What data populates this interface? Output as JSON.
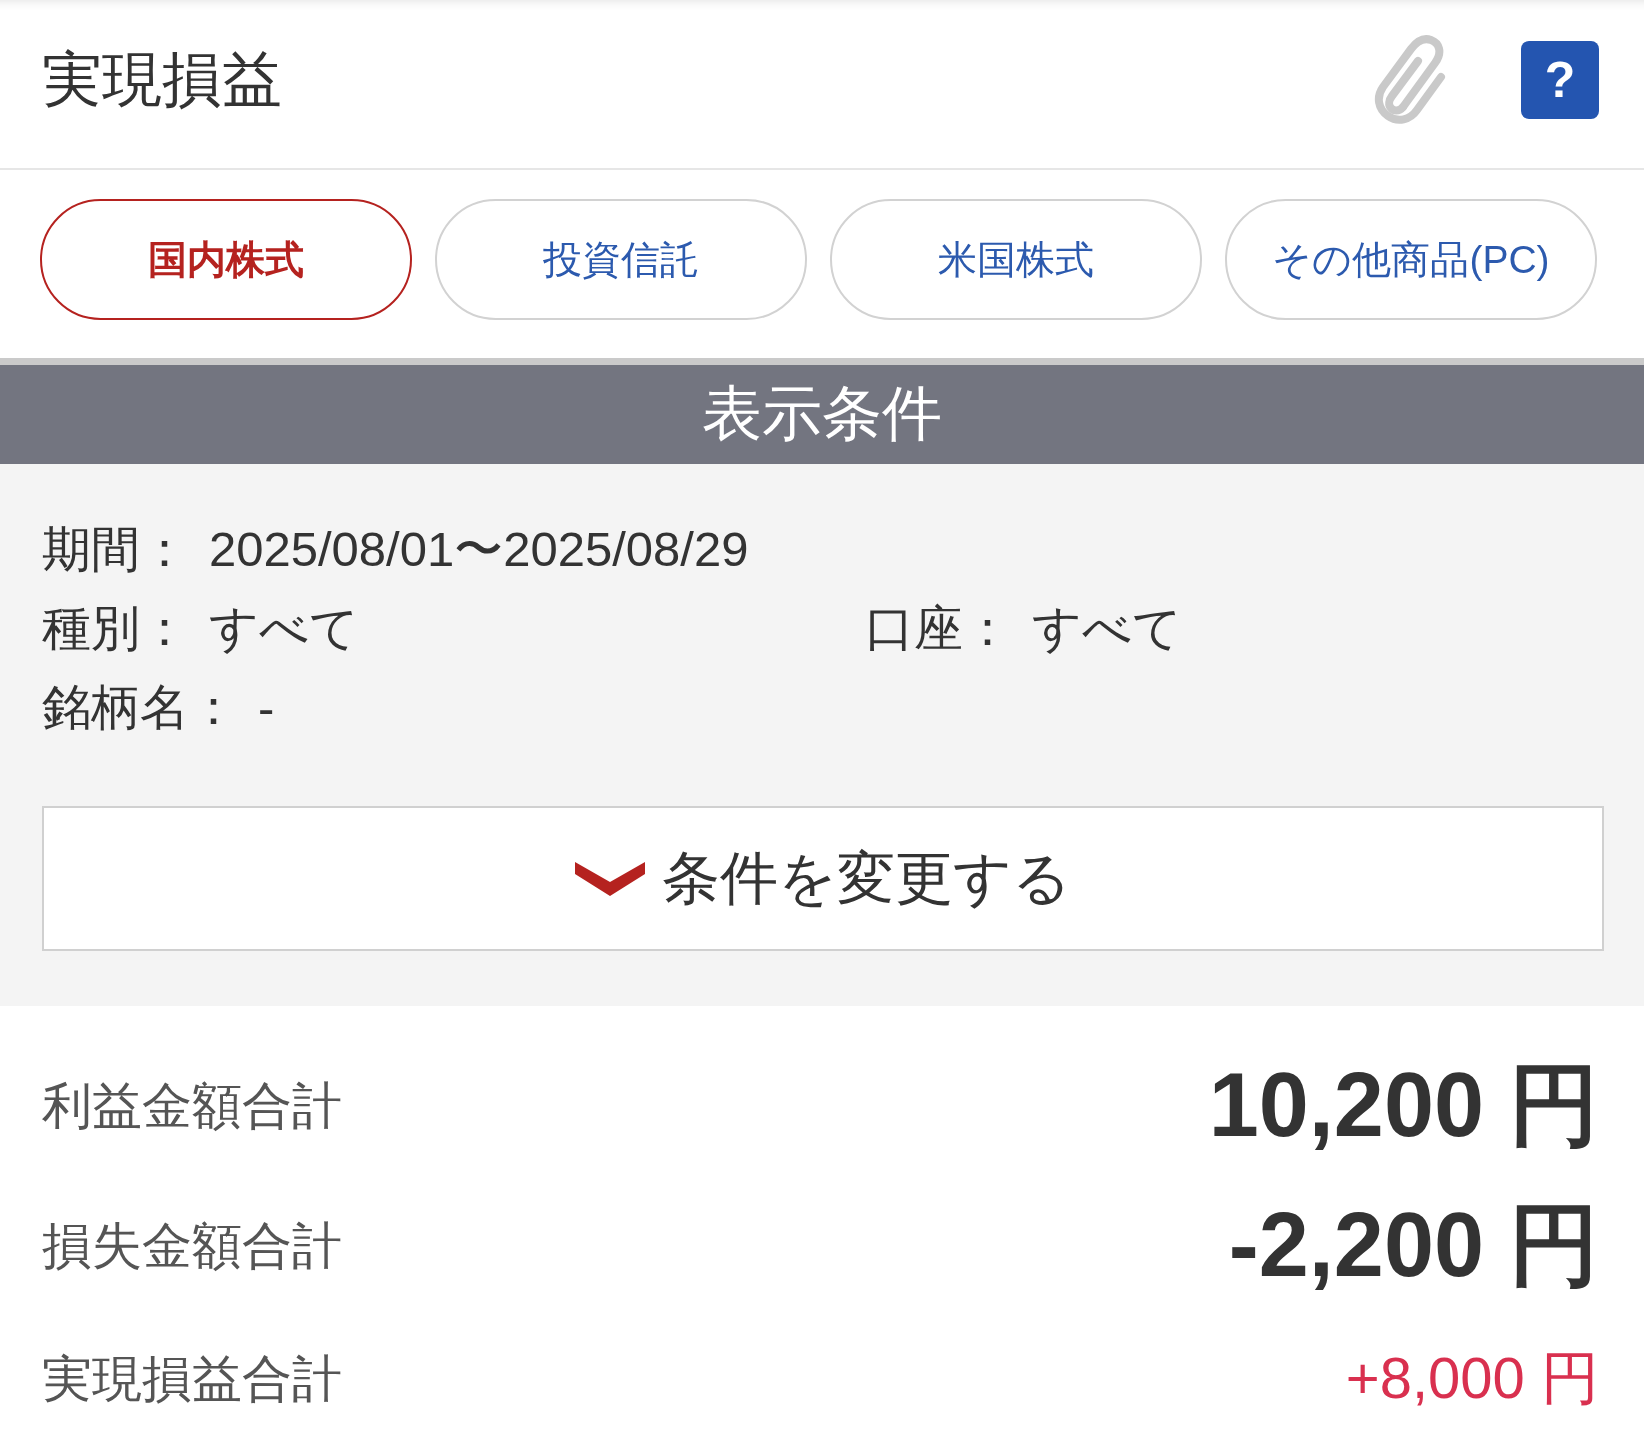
{
  "header": {
    "title": "実現損益",
    "help_button": {
      "label": "?"
    }
  },
  "tabs": [
    {
      "label": "国内株式",
      "selected": true
    },
    {
      "label": "投資信託",
      "selected": false
    },
    {
      "label": "米国株式",
      "selected": false
    },
    {
      "label": "その他商品(PC)",
      "selected": false
    }
  ],
  "conditions": {
    "title": "表示条件",
    "rows": [
      {
        "fields": [
          {
            "label": "期間：",
            "value": "2025/08/01〜2025/08/29"
          }
        ]
      },
      {
        "fields": [
          {
            "label": "種別：",
            "value": "すべて"
          },
          {
            "label": "口座：",
            "value": "すべて"
          }
        ]
      },
      {
        "fields": [
          {
            "label": "銘柄名：",
            "value": "-"
          }
        ]
      }
    ],
    "change_button": {
      "label": "条件を変更する",
      "expanded": false
    }
  },
  "totals": [
    {
      "label": "利益金額合計",
      "value": "10,200 円",
      "kind": "amount"
    },
    {
      "label": "損失金額合計",
      "value": "-2,200 円",
      "kind": "amount"
    },
    {
      "label": "実現損益合計",
      "value": "+8,000 円",
      "kind": "net"
    }
  ]
}
